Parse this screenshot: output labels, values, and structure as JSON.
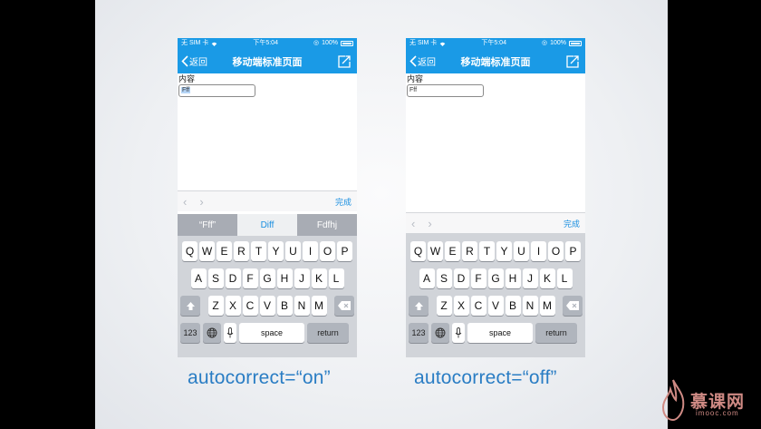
{
  "status_bar": {
    "carrier": "无 SIM 卡",
    "time": "下午5:04",
    "battery": "100%"
  },
  "nav": {
    "back_label": "返回",
    "title": "移动端标准页面"
  },
  "content": {
    "label": "内容"
  },
  "left_phone": {
    "input_value": "Fff",
    "accessory_done": "完成",
    "suggestions": [
      "“Fff”",
      "Diff",
      "Fdfhj"
    ]
  },
  "right_phone": {
    "input_value": "Fff",
    "accessory_done": "完成"
  },
  "keyboard": {
    "row1": [
      "Q",
      "W",
      "E",
      "R",
      "T",
      "Y",
      "U",
      "I",
      "O",
      "P"
    ],
    "row2": [
      "A",
      "S",
      "D",
      "F",
      "G",
      "H",
      "J",
      "K",
      "L"
    ],
    "row3": [
      "Z",
      "X",
      "C",
      "V",
      "B",
      "N",
      "M"
    ],
    "numbers_key": "123",
    "space_key": "space",
    "return_key": "return"
  },
  "captions": {
    "left": "autocorrect=“on”",
    "right": "autocorrect=“off”"
  },
  "watermark": {
    "brand": "慕课网",
    "domain": "imooc.com"
  },
  "colors": {
    "nav_blue": "#1a9ae6",
    "caption_blue": "#2a7dc4",
    "done_blue": "#1a8fe0",
    "keyboard_bg": "#d1d4d9"
  }
}
